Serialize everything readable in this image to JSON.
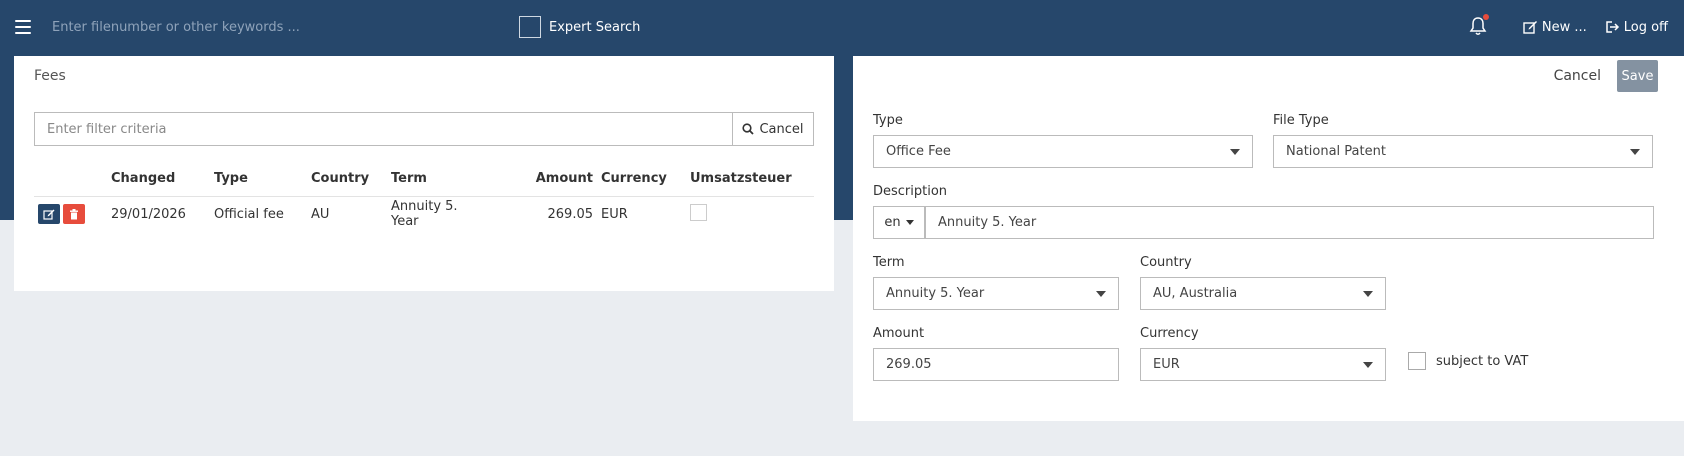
{
  "topbar": {
    "search_placeholder": "Enter filenumber or other keywords ...",
    "expert_search_label": "Expert Search",
    "new_label": "New ...",
    "logoff_label": "Log off"
  },
  "fees_panel": {
    "title": "Fees",
    "filter_placeholder": "Enter filter criteria",
    "cancel_label": "Cancel",
    "columns": [
      "Changed",
      "Type",
      "Country",
      "Term",
      "Amount",
      "Currency",
      "Umsatzsteuer"
    ],
    "rows": [
      {
        "changed": "29/01/2026",
        "type": "Official fee",
        "country": "AU",
        "term": "Annuity 5. Year",
        "amount": "269.05",
        "currency": "EUR",
        "vat_checked": false
      }
    ]
  },
  "form": {
    "cancel_label": "Cancel",
    "save_label": "Save",
    "type_label": "Type",
    "type_value": "Office Fee",
    "file_type_label": "File Type",
    "file_type_value": "National Patent",
    "description_label": "Description",
    "lang_value": "en",
    "description_value": "Annuity 5. Year",
    "term_label": "Term",
    "term_value": "Annuity 5. Year",
    "country_label": "Country",
    "country_value": "AU, Australia",
    "amount_label": "Amount",
    "amount_value": "269.05",
    "currency_label": "Currency",
    "currency_value": "EUR",
    "vat_label": "subject to VAT",
    "vat_checked": false
  },
  "colors": {
    "header_bg": "#26476b",
    "edit_button": "#26476b",
    "delete_button": "#e74c3c",
    "save_button": "#8492a1",
    "page_bg": "#eaedf1"
  }
}
